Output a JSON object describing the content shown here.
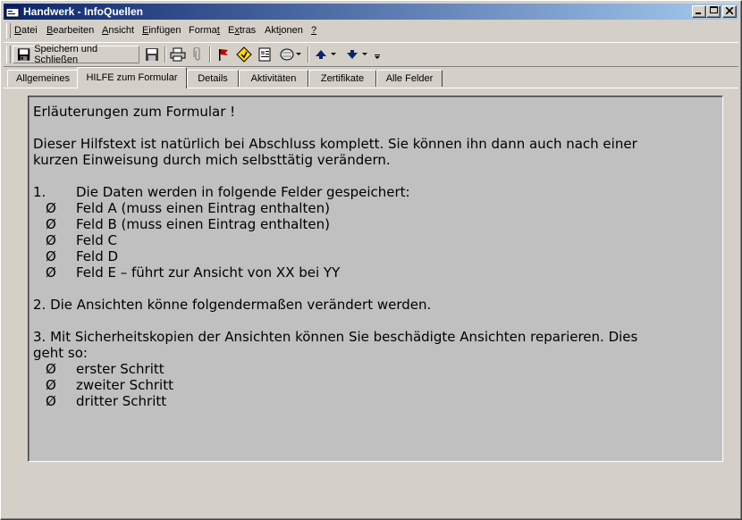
{
  "window": {
    "title": "Handwerk - InfoQuellen"
  },
  "menu": [
    {
      "acc": "D",
      "rest": "atei"
    },
    {
      "acc": "B",
      "rest": "earbeiten"
    },
    {
      "acc": "A",
      "rest": "nsicht"
    },
    {
      "acc": "E",
      "rest": "infügen"
    },
    {
      "pre": "Forma",
      "acc": "t",
      "rest": ""
    },
    {
      "pre": "E",
      "acc": "x",
      "rest": "tras"
    },
    {
      "pre": "Akt",
      "acc": "i",
      "rest": "onen"
    },
    {
      "acc": "?",
      "rest": ""
    }
  ],
  "toolbar": {
    "save_label": "Speichern und Schließen"
  },
  "tabs": [
    "Allgemeines",
    "HILFE zum Formular",
    "Details",
    "Aktivitäten",
    "Zertifikate",
    "Alle Felder"
  ],
  "content": {
    "heading": "Erläuterungen zum Formular !",
    "intro_line1": "Dieser Hilfstext ist natürlich bei Abschluss komplett. Sie können ihn dann auch nach einer",
    "intro_line2": "kurzen Einweisung durch mich selbsttätig verändern.",
    "item1_num": "1.",
    "item1_text": "Die Daten werden in folgende Felder gespeichert:",
    "bullet_char": "Ø",
    "fields": [
      "Feld A (muss einen Eintrag enthalten)",
      "Feld B (muss einen Eintrag enthalten)",
      "Feld C",
      "Feld D",
      "Feld E – führt zur Ansicht von XX bei YY"
    ],
    "item2": "2. Die Ansichten könne folgendermaßen verändert werden.",
    "item3_line1": "3. Mit Sicherheitskopien der Ansichten können Sie beschädigte Ansichten reparieren. Dies",
    "item3_line2": "geht so:",
    "steps": [
      "erster Schritt",
      "zweiter Schritt",
      "dritter Schritt"
    ]
  }
}
